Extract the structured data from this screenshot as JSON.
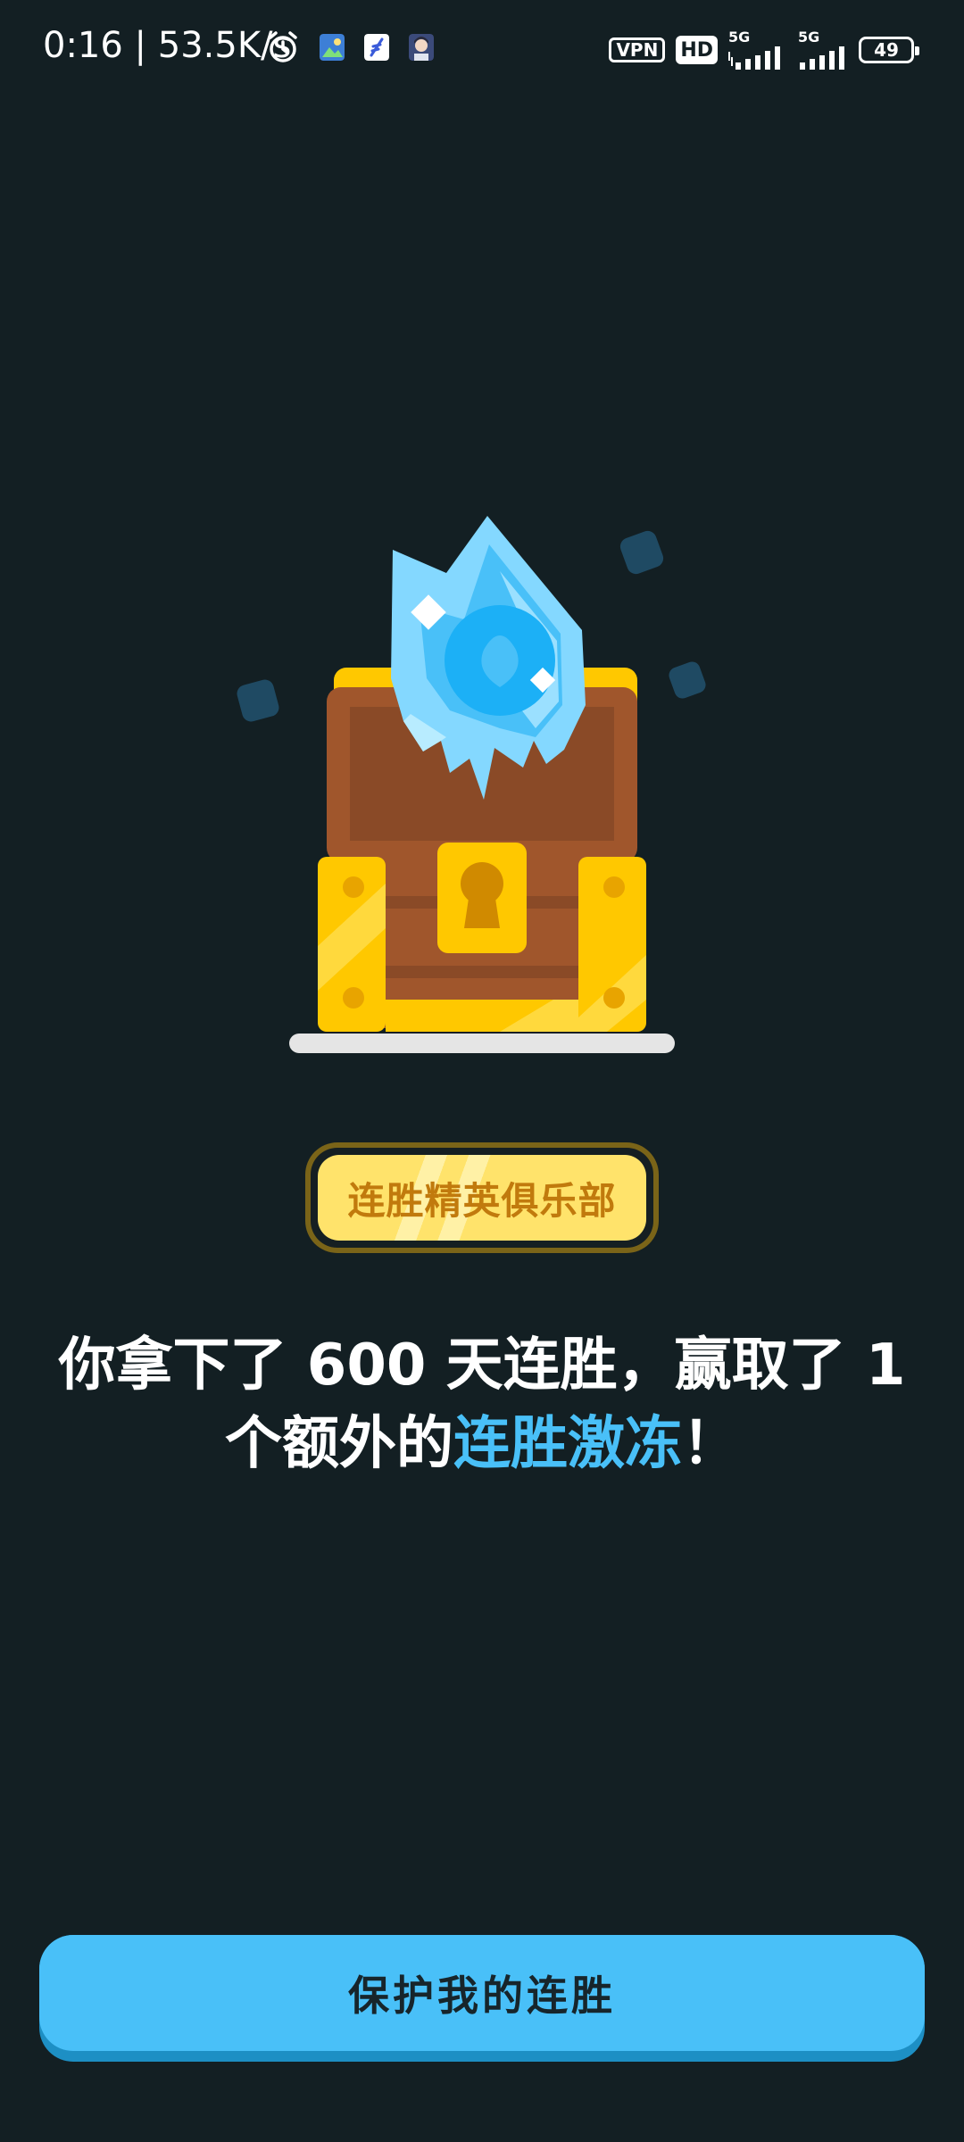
{
  "status_bar": {
    "time": "0:16",
    "speed": "53.5K/s",
    "vpn_label": "VPN",
    "hd_label": "HD",
    "sig1_label": "5G",
    "sig2_label": "5G",
    "battery": "49",
    "icons": [
      "alarm-icon",
      "gallery-app-icon",
      "feather-app-icon",
      "avatar-app-icon"
    ]
  },
  "club_badge": {
    "label": "连胜精英俱乐部"
  },
  "message": {
    "line1": "你拿下了 600 天连胜，赢取了 1",
    "line2_prefix": "个额外的",
    "line2_highlight": "连胜激冻",
    "line2_suffix": "！"
  },
  "cta": {
    "label": "保护我的连胜"
  },
  "colors": {
    "background": "#131f23",
    "accent": "#49c0f8",
    "badge_text": "#c17a0d",
    "badge_fill": "#ffe36b"
  }
}
